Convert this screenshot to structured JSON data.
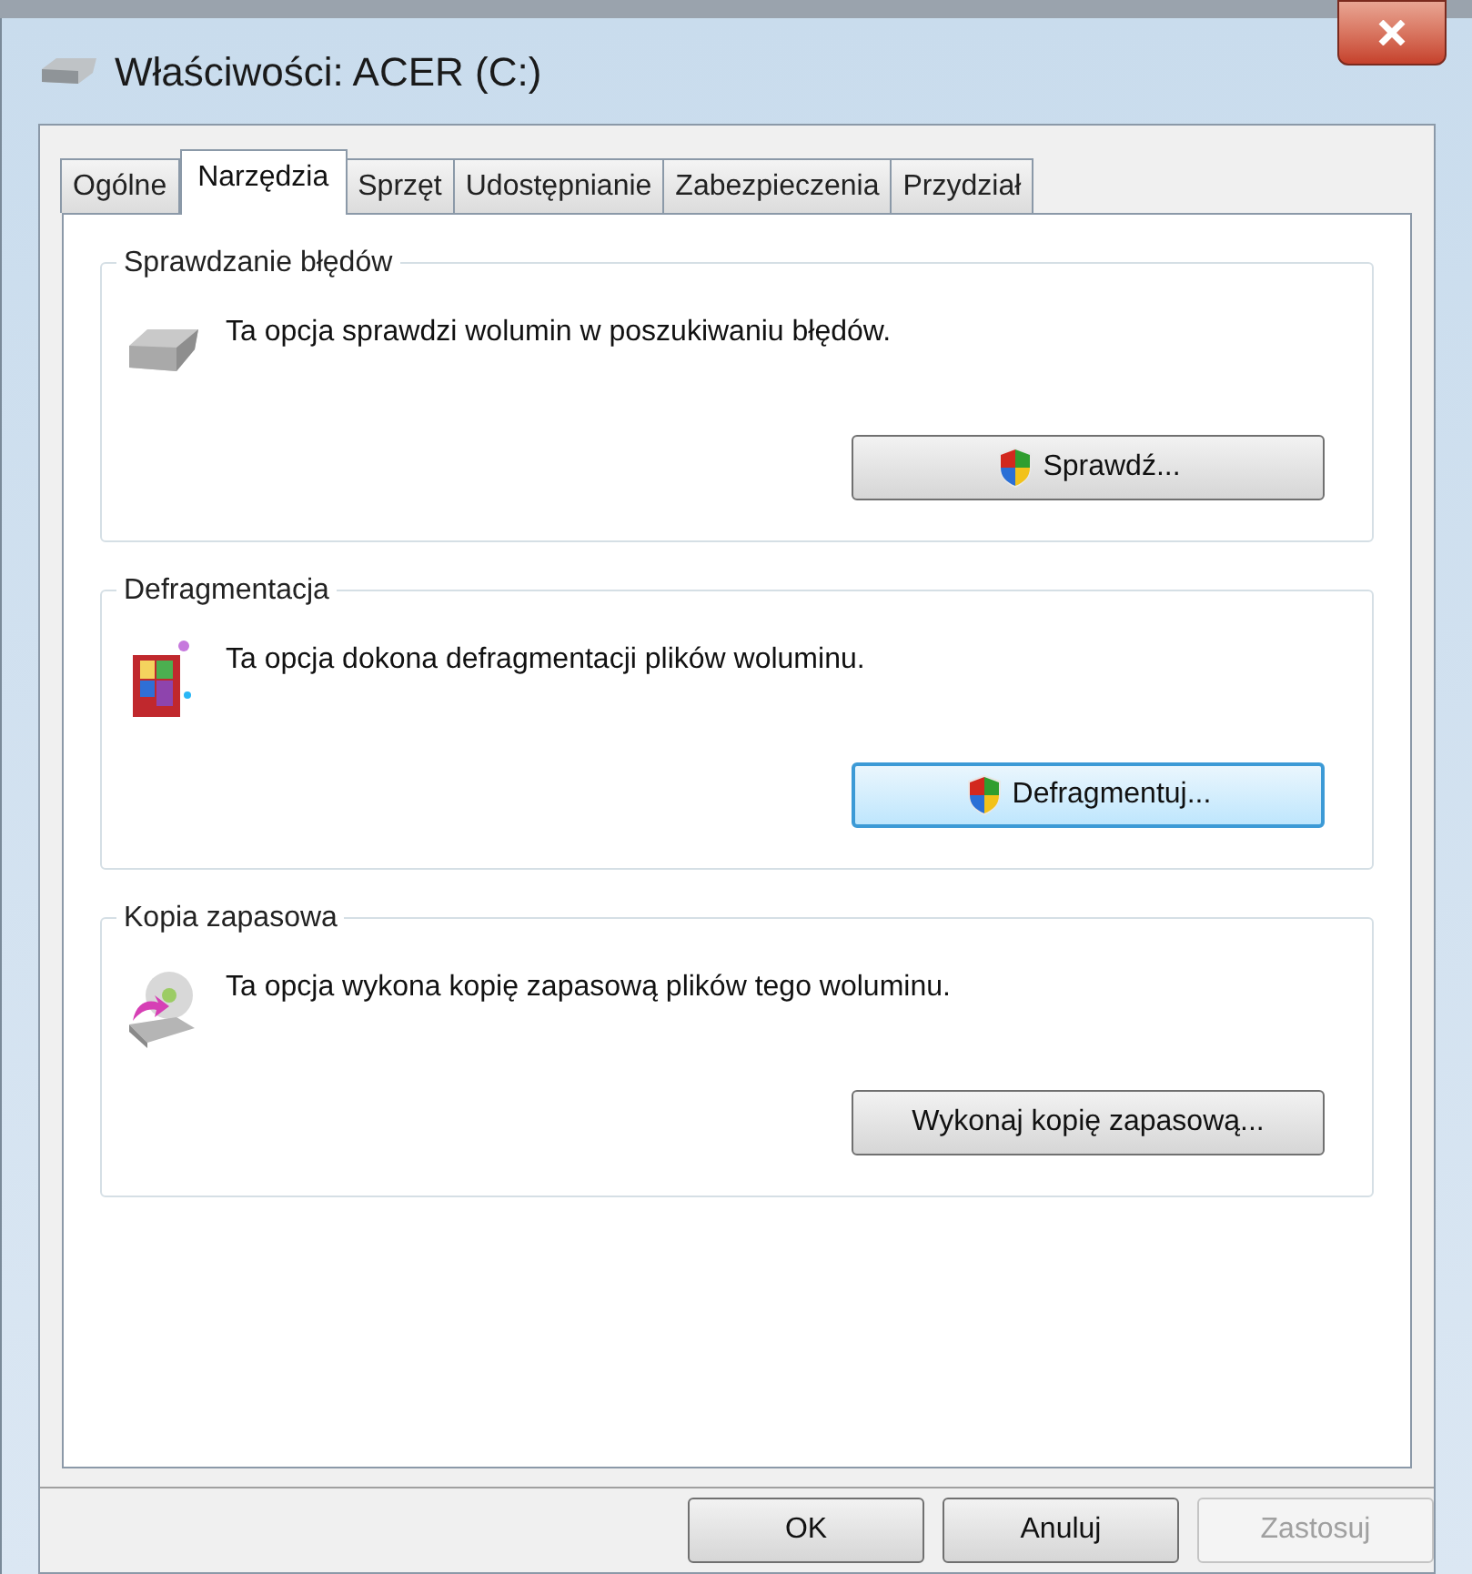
{
  "window": {
    "title": "Właściwości: ACER (C:)"
  },
  "tabs": [
    {
      "label": "Ogólne",
      "selected": false
    },
    {
      "label": "Narzędzia",
      "selected": true
    },
    {
      "label": "Sprzęt",
      "selected": false
    },
    {
      "label": "Udostępnianie",
      "selected": false
    },
    {
      "label": "Zabezpieczenia",
      "selected": false
    },
    {
      "label": "Przydział",
      "selected": false
    }
  ],
  "groups": [
    {
      "title": "Sprawdzanie błędów",
      "kind": "drive",
      "description": "Ta opcja sprawdzi wolumin w poszukiwaniu błędów.",
      "button": {
        "label": "Sprawdź...",
        "shield": true,
        "focused": false
      }
    },
    {
      "title": "Defragmentacja",
      "kind": "defrag",
      "description": "Ta opcja dokona defragmentacji plików woluminu.",
      "button": {
        "label": "Defragmentuj...",
        "shield": true,
        "focused": true
      }
    },
    {
      "title": "Kopia zapasowa",
      "kind": "backup",
      "description": "Ta opcja wykona kopię zapasową plików tego woluminu.",
      "button": {
        "label": "Wykonaj kopię zapasową...",
        "shield": false,
        "focused": false
      }
    }
  ],
  "buttons": [
    {
      "label": "OK",
      "disabled": false
    },
    {
      "label": "Anuluj",
      "disabled": false
    },
    {
      "label": "Zastosuj",
      "disabled": true
    }
  ]
}
